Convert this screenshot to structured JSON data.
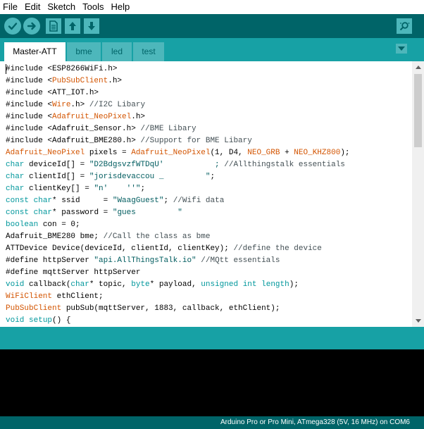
{
  "menu": {
    "items": [
      {
        "label": "File"
      },
      {
        "label": "Edit"
      },
      {
        "label": "Sketch"
      },
      {
        "label": "Tools"
      },
      {
        "label": "Help"
      }
    ]
  },
  "toolbar": {
    "buttons": [
      {
        "name": "verify",
        "icon": "checkmark-icon"
      },
      {
        "name": "upload",
        "icon": "arrow-right-icon"
      },
      {
        "name": "new",
        "icon": "new-file-icon"
      },
      {
        "name": "open",
        "icon": "arrow-up-icon"
      },
      {
        "name": "save",
        "icon": "arrow-down-icon"
      },
      {
        "name": "serial-monitor",
        "icon": "magnifier-icon"
      }
    ]
  },
  "tabs": [
    {
      "label": "Master-ATT",
      "active": true
    },
    {
      "label": "bme",
      "active": false
    },
    {
      "label": "led",
      "active": false
    },
    {
      "label": "test",
      "active": false
    }
  ],
  "editor": {
    "lines": [
      "#include <ESP8266WiFi.h>",
      "#include <PubSubClient.h>",
      "#include <ATT_IOT.h>",
      "#include <Wire.h> //I2C Libary",
      "#include <Adafruit_NeoPixel.h>",
      "#include <Adafruit_Sensor.h> //BME Libary",
      "#include <Adafruit_BME280.h> //Support for BME Libary",
      "Adafruit_NeoPixel pixels = Adafruit_NeoPixel(1, D4, NEO_GRB + NEO_KHZ800);",
      "char deviceId[] = \"D2BdgsvzfWTDqU'           ; //Allthingstalk essentials",
      "char clientId[] = \"jorisdevaccou _         \";",
      "char clientKey[] = \"n'    ''\";",
      "const char* ssid     = \"WaagGuest\"; //Wifi data",
      "const char* password = \"gues         \"",
      "boolean con = 0;",
      "Adafruit_BME280 bme; //Call the class as bme",
      "ATTDevice Device(deviceId, clientId, clientKey); //define the device",
      "#define httpServer \"api.AllThingsTalk.io\" //MQtt essentials",
      "#define mqttServer httpServer",
      "void callback(char* topic, byte* payload, unsigned int length);",
      "WiFiClient ethClient;",
      "PubSubClient pubSub(mqttServer, 1883, callback, ethClient);",
      "void setup() {"
    ]
  },
  "status_bar": {
    "board": "Arduino Pro or Pro Mini, ATmega328 (5V, 16 MHz) on COM6"
  },
  "colors": {
    "toolbar_bg": "#006468",
    "tab_strip_bg": "#17a1a5",
    "tab_inactive_bg": "#4db7bb",
    "console_bg": "#000000",
    "keyword_orange": "#d35400",
    "keyword_teal": "#00979c"
  }
}
